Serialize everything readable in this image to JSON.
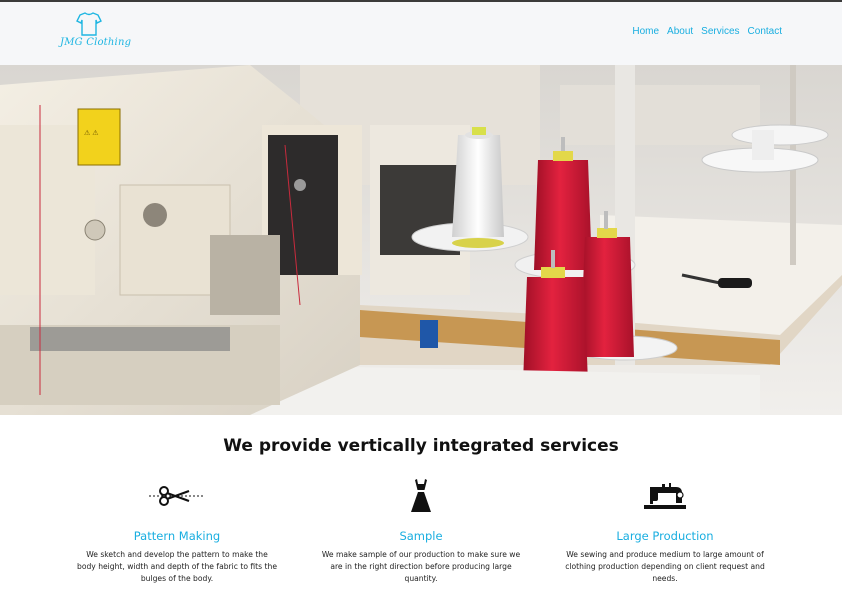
{
  "brand": {
    "name": "JMG Clothing"
  },
  "nav": {
    "items": [
      "Home",
      "About",
      "Services",
      "Contact"
    ]
  },
  "hero": {
    "image": "sewing-factory-photo"
  },
  "section": {
    "title": "We provide vertically integrated services"
  },
  "services": [
    {
      "icon": "scissors-icon",
      "title": "Pattern Making",
      "text": "We sketch and develop the pattern to make the body height, width and depth of the fabric to fits the bulges of the body."
    },
    {
      "icon": "dress-icon",
      "title": "Sample",
      "text": "We make sample of our production to make sure we are in the right direction before producing large quantity."
    },
    {
      "icon": "sewing-machine-icon",
      "title": "Large Production",
      "text": "We sewing and produce medium to large amount of clothing production depending on client request and needs."
    }
  ],
  "colors": {
    "accent": "#19aee0",
    "header_bg": "#f6f7f9",
    "thread_red": "#d8173a"
  }
}
